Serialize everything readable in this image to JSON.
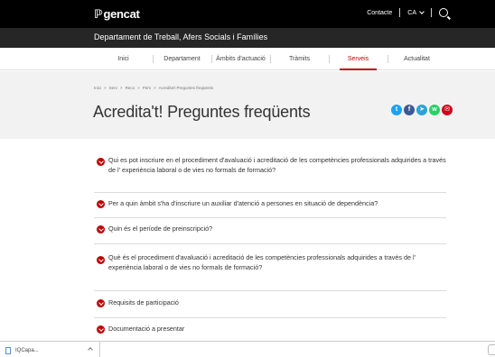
{
  "header": {
    "logo_mark": "ℙ",
    "logo_text": "gencat",
    "contact_label": "Contacte",
    "language": "CA"
  },
  "department": "Departament de Treball, Afers Socials i Famílies",
  "nav": {
    "items": [
      {
        "label": "Inici"
      },
      {
        "label": "Departament"
      },
      {
        "label": "Àmbits d'actuació"
      },
      {
        "label": "Tràmits"
      },
      {
        "label": "Serveis",
        "active": true
      },
      {
        "label": "Actualitat"
      }
    ]
  },
  "breadcrumb": [
    "Inici",
    "Serv",
    "Reco",
    "Pers",
    "Acredita't Preguntes freqüents"
  ],
  "page_title": "Acredita't! Preguntes freqüents",
  "share": [
    {
      "icon": "twitter-icon",
      "glyph": "t",
      "color": "#1da1f2"
    },
    {
      "icon": "facebook-icon",
      "glyph": "f",
      "color": "#3b5998"
    },
    {
      "icon": "telegram-icon",
      "glyph": "➤",
      "color": "#2aa3d8"
    },
    {
      "icon": "whatsapp-icon",
      "glyph": "w",
      "color": "#25d366"
    },
    {
      "icon": "email-icon",
      "glyph": "✉",
      "color": "#d0021b"
    }
  ],
  "faq": [
    {
      "text": "Qui es pot inscriure en el procediment d'avaluació i acreditació de les competències professionals adquirides a través de l' experiència laboral o de vies no formals de formació?"
    },
    {
      "text": "Per a quin àmbit s'ha d'inscriure un auxiliar d'atenció a persones en situació de dependència?"
    },
    {
      "text": "Quin és el període de preinscripció?"
    },
    {
      "text": "Què és el procediment d'avaluació i acreditació de les competències professionals adquirides a través de l' experiència laboral o de vies no formals de formació?"
    },
    {
      "text": "Requisits de participació"
    },
    {
      "text": "Documentació a presentar"
    }
  ],
  "download": {
    "filename": "IQCapa...",
    "icon": "file-icon"
  },
  "colors": {
    "accent": "#c00000",
    "topbar": "#000000",
    "deptbar": "#262626",
    "hero": "#f2f2f2"
  }
}
